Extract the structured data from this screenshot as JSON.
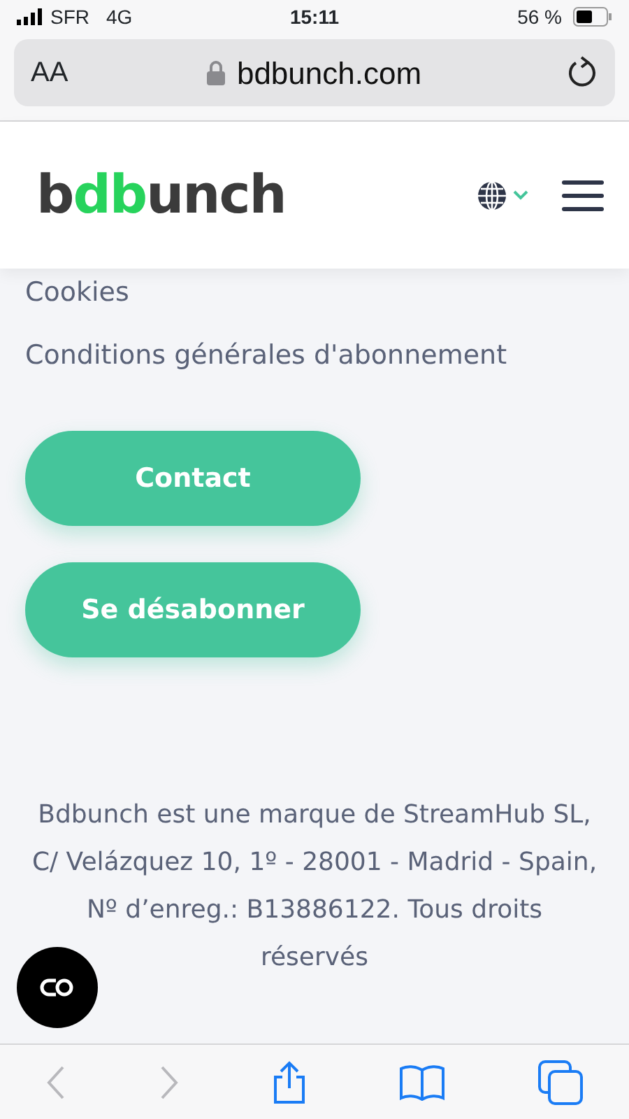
{
  "status_bar": {
    "carrier": "SFR",
    "network": "4G",
    "time": "15:11",
    "battery": "56 %"
  },
  "address_bar": {
    "text_size": "AA",
    "url": "bdbunch.com"
  },
  "header": {
    "logo": "bdbunch"
  },
  "links": [
    "Cookies",
    "Conditions générales d'abonnement"
  ],
  "buttons": [
    "Contact",
    "Se désabonner"
  ],
  "footer": "Bdbunch est une marque de StreamHub SL, C/ Velázquez 10, 1º - 28001 - Madrid - Spain, Nº d’enreg.: B13886122. Tous droits réservés",
  "toolbar": {
    "back_disabled": true,
    "forward_disabled": true
  }
}
